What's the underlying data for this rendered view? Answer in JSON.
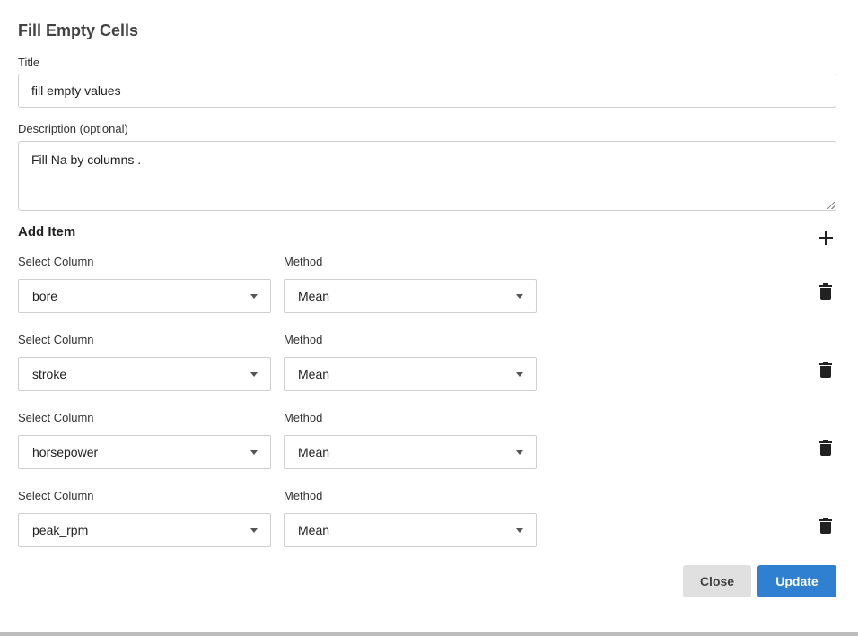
{
  "dialog": {
    "title": "Fill Empty Cells"
  },
  "form": {
    "title_label": "Title",
    "title_value": "fill empty values",
    "description_label": "Description (optional)",
    "description_value": "Fill Na by columns ."
  },
  "items": {
    "section_title": "Add Item",
    "rows": [
      {
        "column_label": "Select Column",
        "column_value": "bore",
        "method_label": "Method",
        "method_value": "Mean"
      },
      {
        "column_label": "Select Column",
        "column_value": "stroke",
        "method_label": "Method",
        "method_value": "Mean"
      },
      {
        "column_label": "Select Column",
        "column_value": "horsepower",
        "method_label": "Method",
        "method_value": "Mean"
      },
      {
        "column_label": "Select Column",
        "column_value": "peak_rpm",
        "method_label": "Method",
        "method_value": "Mean"
      }
    ]
  },
  "icons": {
    "add": "plus-icon",
    "delete": "trash-icon",
    "dropdown": "caret-down-icon"
  },
  "actions": {
    "close_label": "Close",
    "update_label": "Update"
  },
  "colors": {
    "primary": "#2f80d1",
    "secondary": "#e0e0e0"
  }
}
